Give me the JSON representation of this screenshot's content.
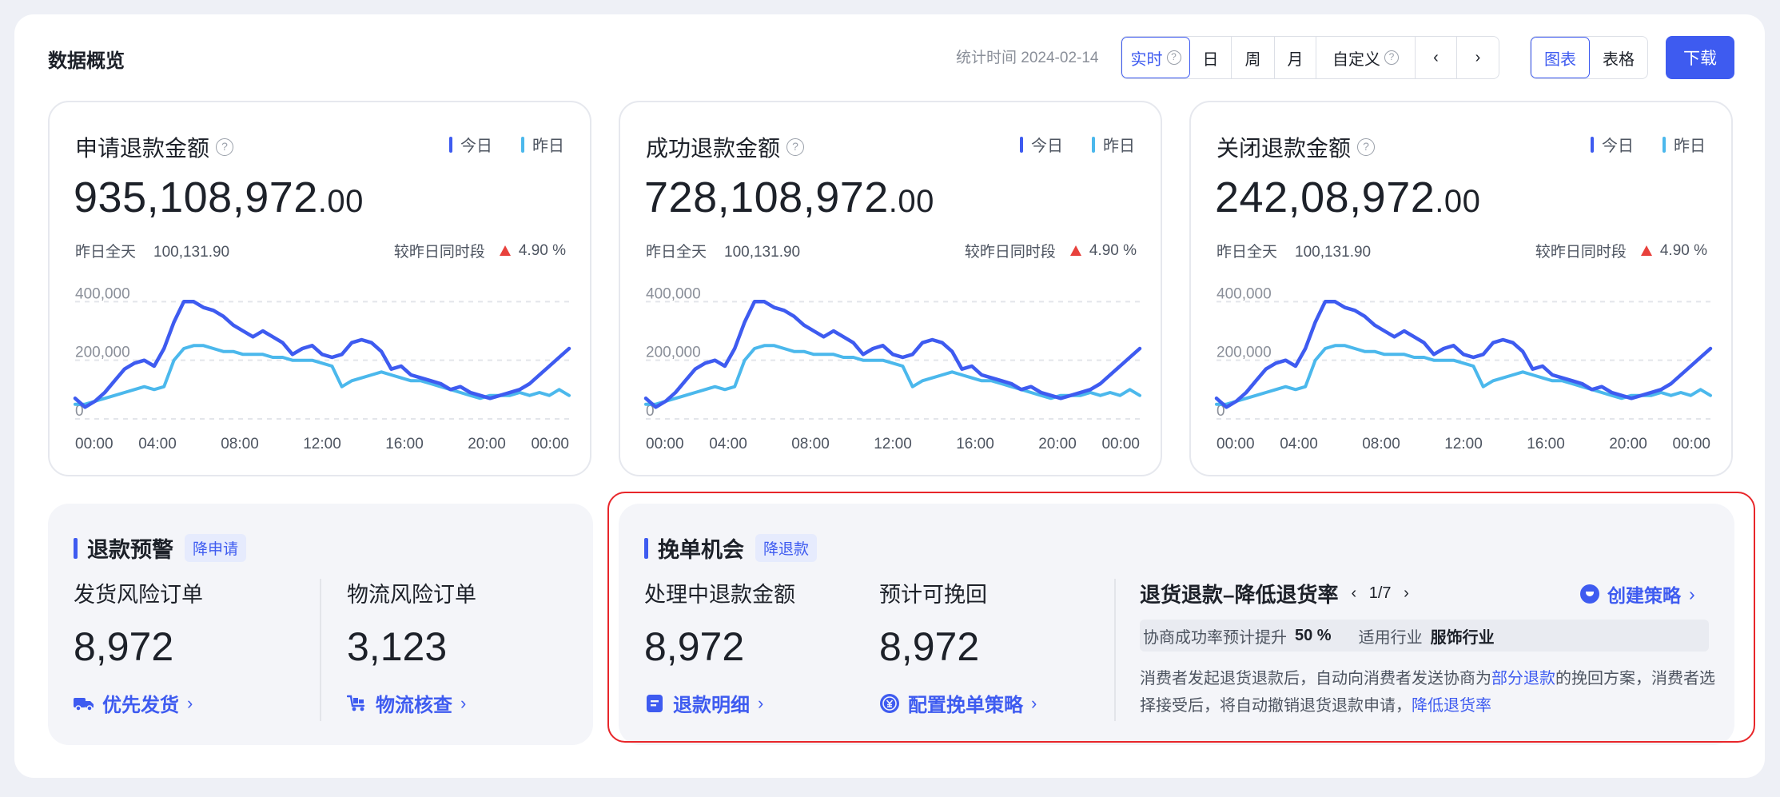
{
  "header": {
    "title": "数据概览",
    "stat_time": "统计时间 2024-02-14",
    "range_tabs": [
      "实时",
      "日",
      "周",
      "月",
      "自定义"
    ],
    "view_tabs": [
      "图表",
      "表格"
    ],
    "download": "下载"
  },
  "legend": {
    "today": "今日",
    "yesterday": "昨日"
  },
  "colors": {
    "today": "#3e5bf0",
    "yesterday": "#4bb8ec",
    "accent": "#3e5bf0",
    "up": "#e8413c"
  },
  "cards": [
    {
      "title": "申请退款金额",
      "value_int": "935,108,972",
      "value_dec": ".00",
      "yday_label": "昨日全天",
      "yday_value": "100,131.90",
      "cmp_label": "较昨日同时段",
      "cmp_value": "4.90 %"
    },
    {
      "title": "成功退款金额",
      "value_int": "728,108,972",
      "value_dec": ".00",
      "yday_label": "昨日全天",
      "yday_value": "100,131.90",
      "cmp_label": "较昨日同时段",
      "cmp_value": "4.90 %"
    },
    {
      "title": "关闭退款金额",
      "value_int": "242,08,972",
      "value_dec": ".00",
      "yday_label": "昨日全天",
      "yday_value": "100,131.90",
      "cmp_label": "较昨日同时段",
      "cmp_value": "4.90 %"
    }
  ],
  "chart_data": {
    "type": "line",
    "ylabels": [
      "400,000",
      "200,000",
      "0"
    ],
    "xlabels": [
      "00:00",
      "04:00",
      "08:00",
      "12:00",
      "16:00",
      "20:00",
      "00:00"
    ],
    "ylim": [
      0,
      480000
    ],
    "grid": true,
    "series": [
      {
        "name": "今日",
        "values": [
          70000,
          40000,
          60000,
          90000,
          130000,
          170000,
          190000,
          200000,
          180000,
          240000,
          330000,
          400000,
          400000,
          380000,
          370000,
          350000,
          320000,
          300000,
          280000,
          300000,
          280000,
          260000,
          220000,
          240000,
          250000,
          220000,
          210000,
          220000,
          260000,
          270000,
          260000,
          230000,
          170000,
          180000,
          150000,
          140000,
          130000,
          120000,
          100000,
          110000,
          90000,
          80000,
          70000,
          80000,
          90000,
          100000,
          120000,
          150000,
          180000,
          210000,
          240000
        ]
      },
      {
        "name": "昨日",
        "values": [
          50000,
          50000,
          60000,
          70000,
          80000,
          90000,
          100000,
          110000,
          100000,
          110000,
          200000,
          240000,
          250000,
          250000,
          240000,
          230000,
          230000,
          220000,
          220000,
          220000,
          210000,
          210000,
          200000,
          200000,
          200000,
          190000,
          180000,
          110000,
          130000,
          140000,
          150000,
          160000,
          150000,
          140000,
          130000,
          130000,
          120000,
          110000,
          100000,
          90000,
          80000,
          70000,
          80000,
          80000,
          80000,
          90000,
          80000,
          90000,
          80000,
          100000,
          80000
        ]
      }
    ]
  },
  "warning": {
    "title": "退款预警",
    "tag": "降申请",
    "items": [
      {
        "label": "发货风险订单",
        "value": "8,972",
        "link": "优先发货"
      },
      {
        "label": "物流风险订单",
        "value": "3,123",
        "link": "物流核查"
      }
    ]
  },
  "opportunity": {
    "title": "挽单机会",
    "tag": "降退款",
    "items": [
      {
        "label": "处理中退款金额",
        "value": "8,972",
        "link": "退款明细"
      },
      {
        "label": "预计可挽回",
        "value": "8,972",
        "link": "配置挽单策略"
      }
    ],
    "strategy": {
      "title": "退货退款–降低退货率",
      "pager": "1/7",
      "create": "创建策略",
      "rate_label": "协商成功率预计提升",
      "rate_value": "50 %",
      "industry_label": "适用行业",
      "industry_value": "服饰行业",
      "desc_1": "消费者发起退货退款后，自动向消费者发送协商为",
      "desc_hl1": "部分退款",
      "desc_2": "的挽回方案，消费者选择接受后，将自动撤销退货退款申请，",
      "desc_hl2": "降低退货率"
    }
  }
}
